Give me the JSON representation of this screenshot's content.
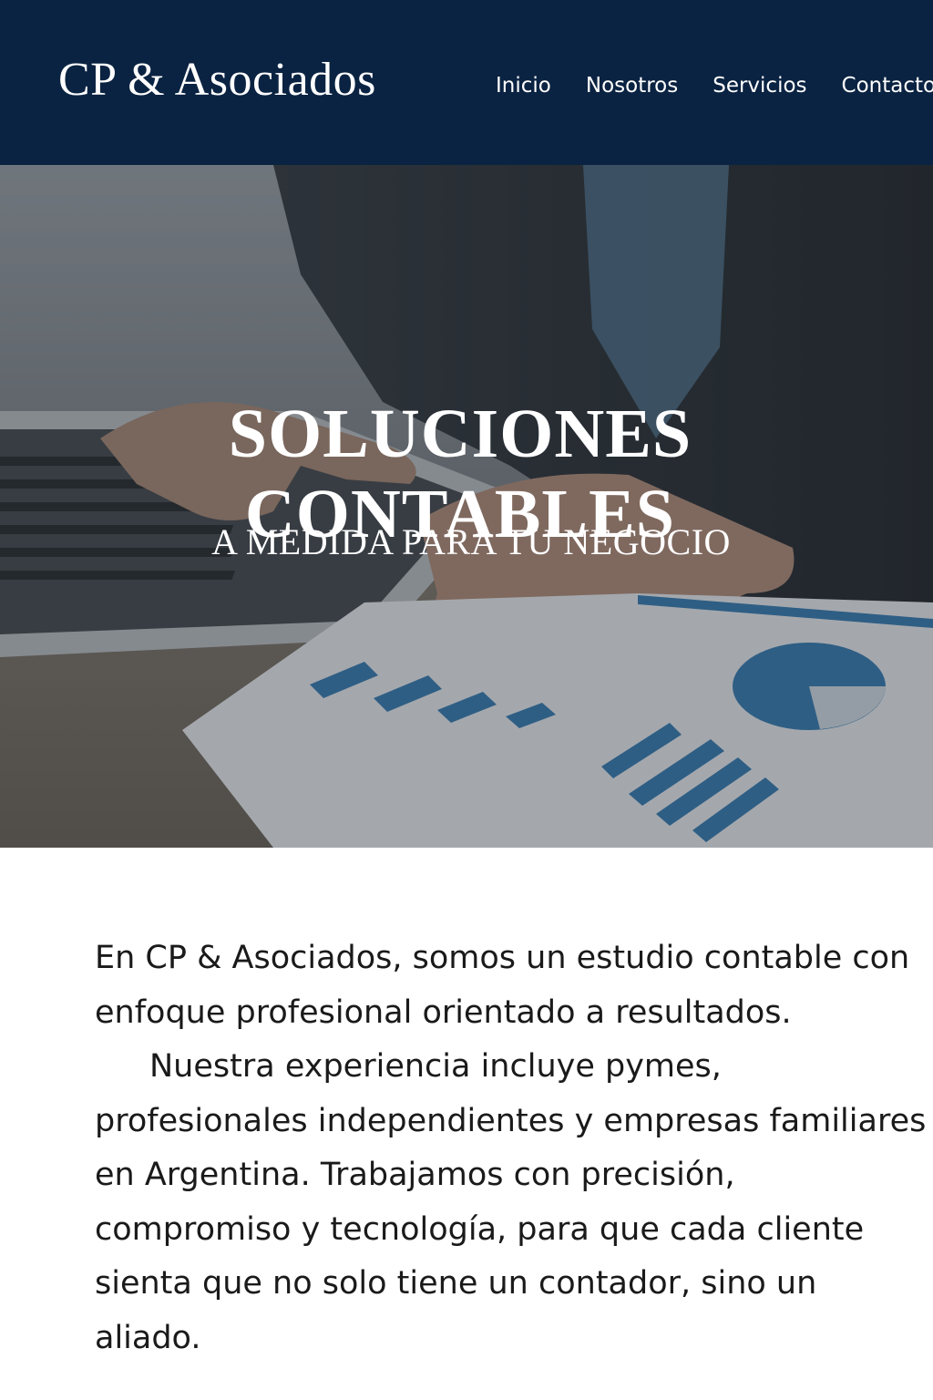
{
  "header": {
    "logo": "CP & Asociados",
    "nav": [
      "Inicio",
      "Nosotros",
      "Servicios",
      "Contacto"
    ]
  },
  "hero": {
    "title_line1": "SOLUCIONES",
    "title_line2": "CONTABLES",
    "subtitle": "A MEDIDA PARA TU NEGOCIO"
  },
  "intro": {
    "paragraph1": "En CP & Asociados, somos un estudio contable con enfoque profesional orientado a resultados.",
    "paragraph2": "Nuestra experiencia incluye pymes, profesionales independientes y empresas familiares en Argentina. Trabajamos con precisión, compromiso y tecnología, para que cada cliente sienta que no solo tiene un contador, sino un aliado."
  },
  "colors": {
    "header_bg": "#0b2342",
    "chart_blue": "#3e7eb0"
  }
}
